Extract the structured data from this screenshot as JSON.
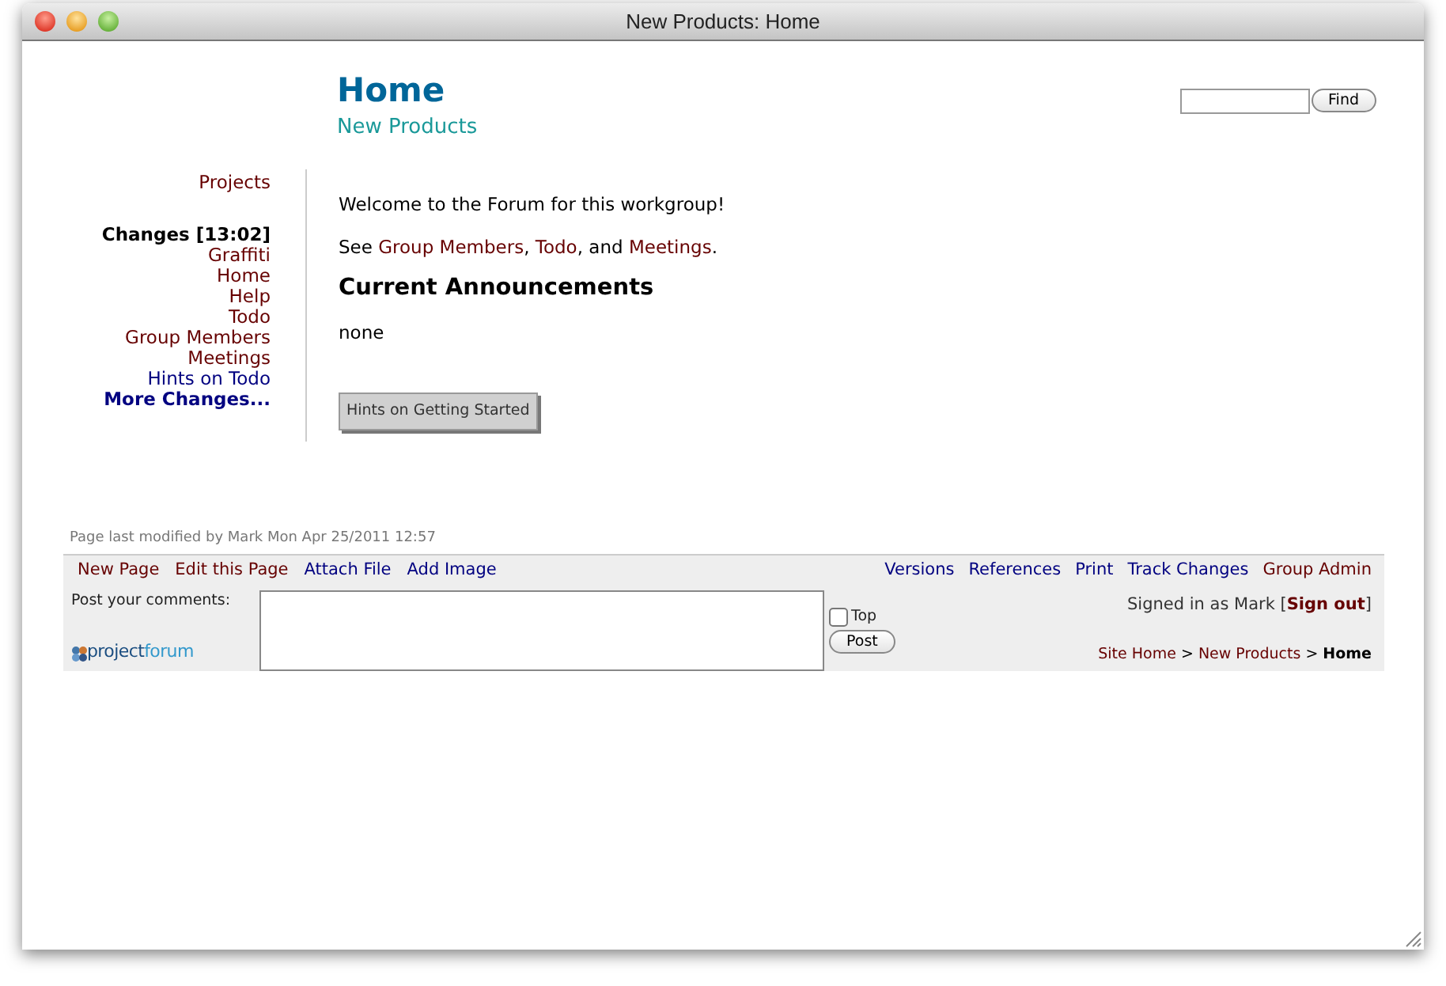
{
  "window": {
    "title": "New Products: Home"
  },
  "header": {
    "title": "Home",
    "subtitle": "New Products"
  },
  "search": {
    "button": "Find"
  },
  "sidebar": {
    "projects": {
      "label": "Projects",
      "visited": true
    },
    "changes_heading": "Changes [13:02]",
    "items": [
      {
        "label": "Graffiti",
        "visited": true
      },
      {
        "label": "Home",
        "visited": true
      },
      {
        "label": "Help",
        "visited": true
      },
      {
        "label": "Todo",
        "visited": true
      },
      {
        "label": "Group Members",
        "visited": true
      },
      {
        "label": "Meetings",
        "visited": true
      },
      {
        "label": "Hints on Todo",
        "visited": false
      }
    ],
    "more": "More Changes..."
  },
  "content": {
    "welcome": "Welcome to the Forum for this workgroup!",
    "see": {
      "lead": "See ",
      "links": [
        {
          "text": "Group Members",
          "after": ", "
        },
        {
          "text": "Todo",
          "after": ", and "
        },
        {
          "text": "Meetings",
          "after": "."
        }
      ]
    },
    "announcements_heading": "Current Announcements",
    "announcements": "none",
    "hints_button": "Hints on Getting Started"
  },
  "modified": "Page last modified by Mark Mon Apr 25/2011 12:57",
  "toolbar": {
    "left": [
      {
        "label": "New Page",
        "visited": true
      },
      {
        "label": "Edit this Page",
        "visited": true
      },
      {
        "label": "Attach File",
        "visited": false
      },
      {
        "label": "Add Image",
        "visited": false
      }
    ],
    "right": [
      {
        "label": "Versions",
        "visited": false
      },
      {
        "label": "References",
        "visited": false
      },
      {
        "label": "Print",
        "visited": false
      },
      {
        "label": "Track Changes",
        "visited": false
      },
      {
        "label": "Group Admin",
        "visited": true
      }
    ]
  },
  "comments": {
    "label": "Post your comments:",
    "top": {
      "label": "Top",
      "checked": false
    },
    "post": "Post"
  },
  "signed_in": {
    "before": "Signed in as Mark [",
    "link": "Sign out",
    "after": "]"
  },
  "logo": {
    "text_a": "project",
    "text_b": "forum"
  },
  "breadcrumb": [
    {
      "label": "Site Home",
      "current": false,
      "kind": "crumb"
    },
    {
      "label": ">",
      "kind": "separator"
    },
    {
      "label": "New Products",
      "current": false,
      "kind": "crumb"
    },
    {
      "label": ">",
      "kind": "separator"
    },
    {
      "label": "Home",
      "current": true,
      "kind": "crumb"
    }
  ]
}
